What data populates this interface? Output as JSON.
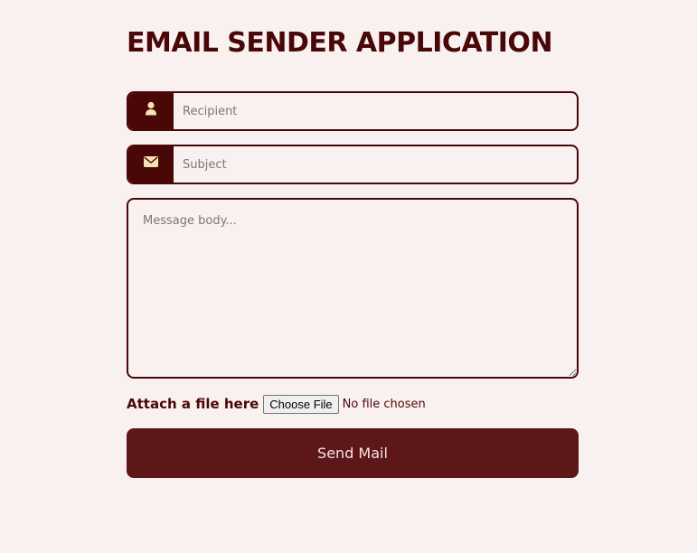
{
  "header": {
    "title": "EMAIL SENDER APPLICATION"
  },
  "form": {
    "recipient": {
      "icon": "user-icon",
      "placeholder": "Recipient",
      "value": ""
    },
    "subject": {
      "icon": "envelope-icon",
      "placeholder": "Subject",
      "value": ""
    },
    "message": {
      "placeholder": "Message body...",
      "value": ""
    },
    "attachment": {
      "label": "Attach a file here",
      "button_label": "Choose File",
      "status": "No file chosen"
    },
    "send_label": "Send Mail"
  },
  "colors": {
    "background": "#f9f1f0",
    "primary": "#4a0707",
    "button": "#5d1719",
    "icon": "#f6e3b4"
  }
}
